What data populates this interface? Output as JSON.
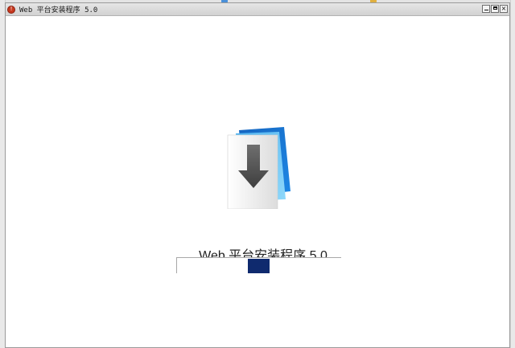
{
  "window": {
    "title": "Web 平台安装程序 5.0"
  },
  "content": {
    "product_title": "Web 平台安装程序 5.0"
  },
  "progress": {
    "style": "marquee",
    "state": "indeterminate"
  },
  "icons": {
    "app": "web-platform-installer-icon",
    "logo": "download-arrow-document-icon"
  },
  "colors": {
    "progress_block": "#0f2a6e",
    "logo_blue": "#1e88e5",
    "logo_light_blue": "#64c4f5",
    "app_icon_red": "#c7391f"
  }
}
